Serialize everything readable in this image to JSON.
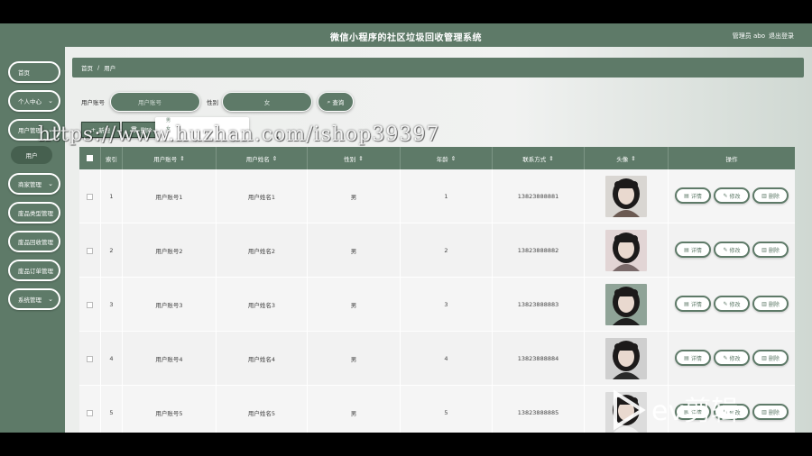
{
  "app": {
    "title": "微信小程序的社区垃圾回收管理系统",
    "user": "管理员 abo",
    "logout": "退出登录"
  },
  "sidebar": {
    "items": [
      {
        "label": "首页",
        "chevron": false
      },
      {
        "label": "个人中心",
        "chevron": true
      },
      {
        "label": "用户管理",
        "chevron": true
      },
      {
        "label": "商家管理",
        "chevron": true
      },
      {
        "label": "废品类型管理",
        "chevron": true
      },
      {
        "label": "废品回收管理",
        "chevron": true
      },
      {
        "label": "废品订单管理",
        "chevron": true
      },
      {
        "label": "系统管理",
        "chevron": true
      }
    ],
    "sub_item": "用户"
  },
  "breadcrumb": {
    "home": "首页",
    "sep": "/",
    "current": "用户"
  },
  "search": {
    "account_label": "用户账号",
    "account_placeholder": "用户账号",
    "gender_label": "性别",
    "gender_value": "女",
    "query_label": "查询",
    "dropdown_options": [
      "男",
      "女"
    ]
  },
  "toolbar": {
    "add_label": "新增",
    "delete_label": "删除"
  },
  "watermark": "https://www.huzhan.com/ishop39397",
  "table": {
    "headers": [
      "索引",
      "用户账号",
      "用户姓名",
      "性别",
      "年龄",
      "联系方式",
      "头像",
      "操作"
    ],
    "sort_icon": "⇕",
    "rows": [
      {
        "index": "1",
        "account": "用户账号1",
        "name": "用户姓名1",
        "gender": "男",
        "age": "1",
        "phone": "13823888881"
      },
      {
        "index": "2",
        "account": "用户账号2",
        "name": "用户姓名2",
        "gender": "男",
        "age": "2",
        "phone": "13823888882"
      },
      {
        "index": "3",
        "account": "用户账号3",
        "name": "用户姓名3",
        "gender": "男",
        "age": "3",
        "phone": "13823888883"
      },
      {
        "index": "4",
        "account": "用户账号4",
        "name": "用户姓名4",
        "gender": "男",
        "age": "4",
        "phone": "13823888884"
      },
      {
        "index": "5",
        "account": "用户账号5",
        "name": "用户姓名5",
        "gender": "男",
        "age": "5",
        "phone": "13823888885"
      }
    ],
    "actions": {
      "detail": "详情",
      "edit": "修改",
      "delete": "删除"
    }
  },
  "overlay": {
    "logo_text": "ev剪辑"
  },
  "colors": {
    "primary": "#5e7a68",
    "dark": "#46604f",
    "background": "#eceeec"
  }
}
